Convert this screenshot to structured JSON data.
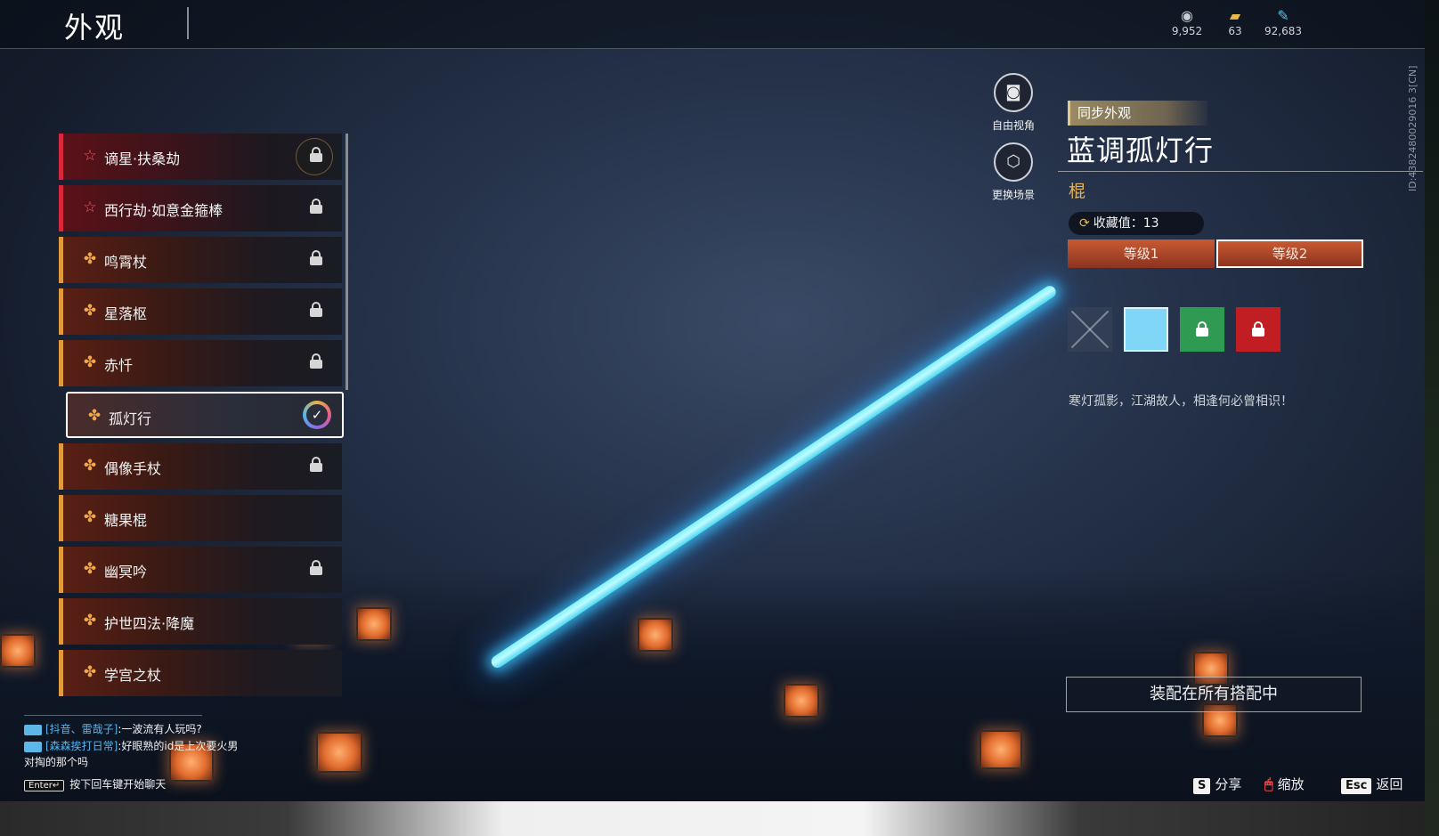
{
  "header": {
    "title": "外观",
    "currencies": [
      {
        "icon": "coin-icon",
        "value": "9,952"
      },
      {
        "icon": "ticket-icon",
        "value": "63"
      },
      {
        "icon": "feather-icon",
        "value": "92,683"
      }
    ]
  },
  "list": {
    "items": [
      {
        "label": "谪星·扶桑劫",
        "icon": "star-outline-icon",
        "status": "locked"
      },
      {
        "label": "西行劫·如意金箍棒",
        "icon": "star-outline-icon",
        "status": "locked"
      },
      {
        "label": "鸣霄杖",
        "icon": "flower-icon",
        "status": "locked"
      },
      {
        "label": "星落枢",
        "icon": "flower-icon",
        "status": "locked"
      },
      {
        "label": "赤忏",
        "icon": "flower-icon",
        "status": "locked"
      },
      {
        "label": "孤灯行",
        "icon": "flower-icon",
        "status": "equipped"
      },
      {
        "label": "偶像手杖",
        "icon": "flower-icon",
        "status": "locked"
      },
      {
        "label": "糖果棍",
        "icon": "flower-icon",
        "status": "owned"
      },
      {
        "label": "幽冥吟",
        "icon": "flower-icon",
        "status": "locked"
      },
      {
        "label": "护世四法·降魔",
        "icon": "flower-icon",
        "status": "owned"
      },
      {
        "label": "学宫之杖",
        "icon": "flower-icon",
        "status": "owned"
      }
    ]
  },
  "camera": {
    "free_view": "自由视角",
    "change_scene": "更换场景"
  },
  "detail": {
    "sync_tag": "同步外观",
    "name": "蓝调孤灯行",
    "type": "棍",
    "collection": "收藏值：13",
    "levels": [
      "等级1",
      "等级2"
    ],
    "active_level": 1,
    "swatches": [
      {
        "kind": "none",
        "color": ""
      },
      {
        "kind": "color",
        "color": "#7fd6f7"
      },
      {
        "kind": "locked",
        "color": "#2f9a52"
      },
      {
        "kind": "locked",
        "color": "#c01e22"
      }
    ],
    "description": "寒灯孤影，江湖故人，相逢何必曾相识！",
    "equip_all": "装配在所有搭配中"
  },
  "id_text": "ID:4382480029016 3[CN]",
  "chat": {
    "lines": [
      {
        "channel": "[抖音、雷哉子]",
        "text": ":一波流有人玩吗?"
      },
      {
        "channel": "[森森挨打日常]",
        "text": ":好眼熟的id是上次要火男"
      }
    ],
    "continuation": "对掏的那个吗",
    "enter_key": "Enter↵",
    "hint": "按下回车键开始聊天"
  },
  "hotkeys": [
    {
      "key": "S",
      "label": "分享"
    },
    {
      "key": "🖱",
      "label": "缩放"
    },
    {
      "key": "Esc",
      "label": "返回"
    }
  ],
  "colors": {
    "accent_orange": "#e39a3a",
    "accent_red": "#d8283a",
    "saber_blue": "#7ef3ff",
    "type_gold": "#e2b35a"
  }
}
